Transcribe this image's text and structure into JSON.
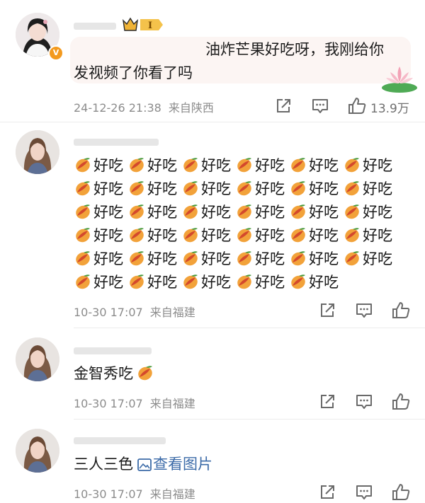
{
  "comments": [
    {
      "text_line1": "油炸芒果好吃呀，我刚给你",
      "text_line2": "发视频了你看了吗",
      "date": "24-12-26 21:38",
      "location": "来自陕西",
      "like_count": "13.9万",
      "level_badge": "I"
    },
    {
      "grid_word": "好吃",
      "row_counts": [
        6,
        6,
        6,
        6,
        6,
        5
      ],
      "date": "10-30 17:07",
      "location": "来自福建"
    },
    {
      "text": "金智秀吃",
      "date": "10-30 17:07",
      "location": "来自福建"
    },
    {
      "text": "三人三色",
      "image_link": "查看图片",
      "date": "10-30 17:07",
      "location": "来自福建"
    }
  ],
  "icons": [
    "share-icon",
    "comment-icon",
    "like-icon",
    "mango-emoji",
    "image-icon",
    "crown-icon",
    "verified-badge"
  ],
  "colors": {
    "meta_gray": "#8c8c8c",
    "badge_orange": "#f39a1f",
    "link_blue": "#3c6ba8",
    "bubble": "#fcf5f3"
  }
}
